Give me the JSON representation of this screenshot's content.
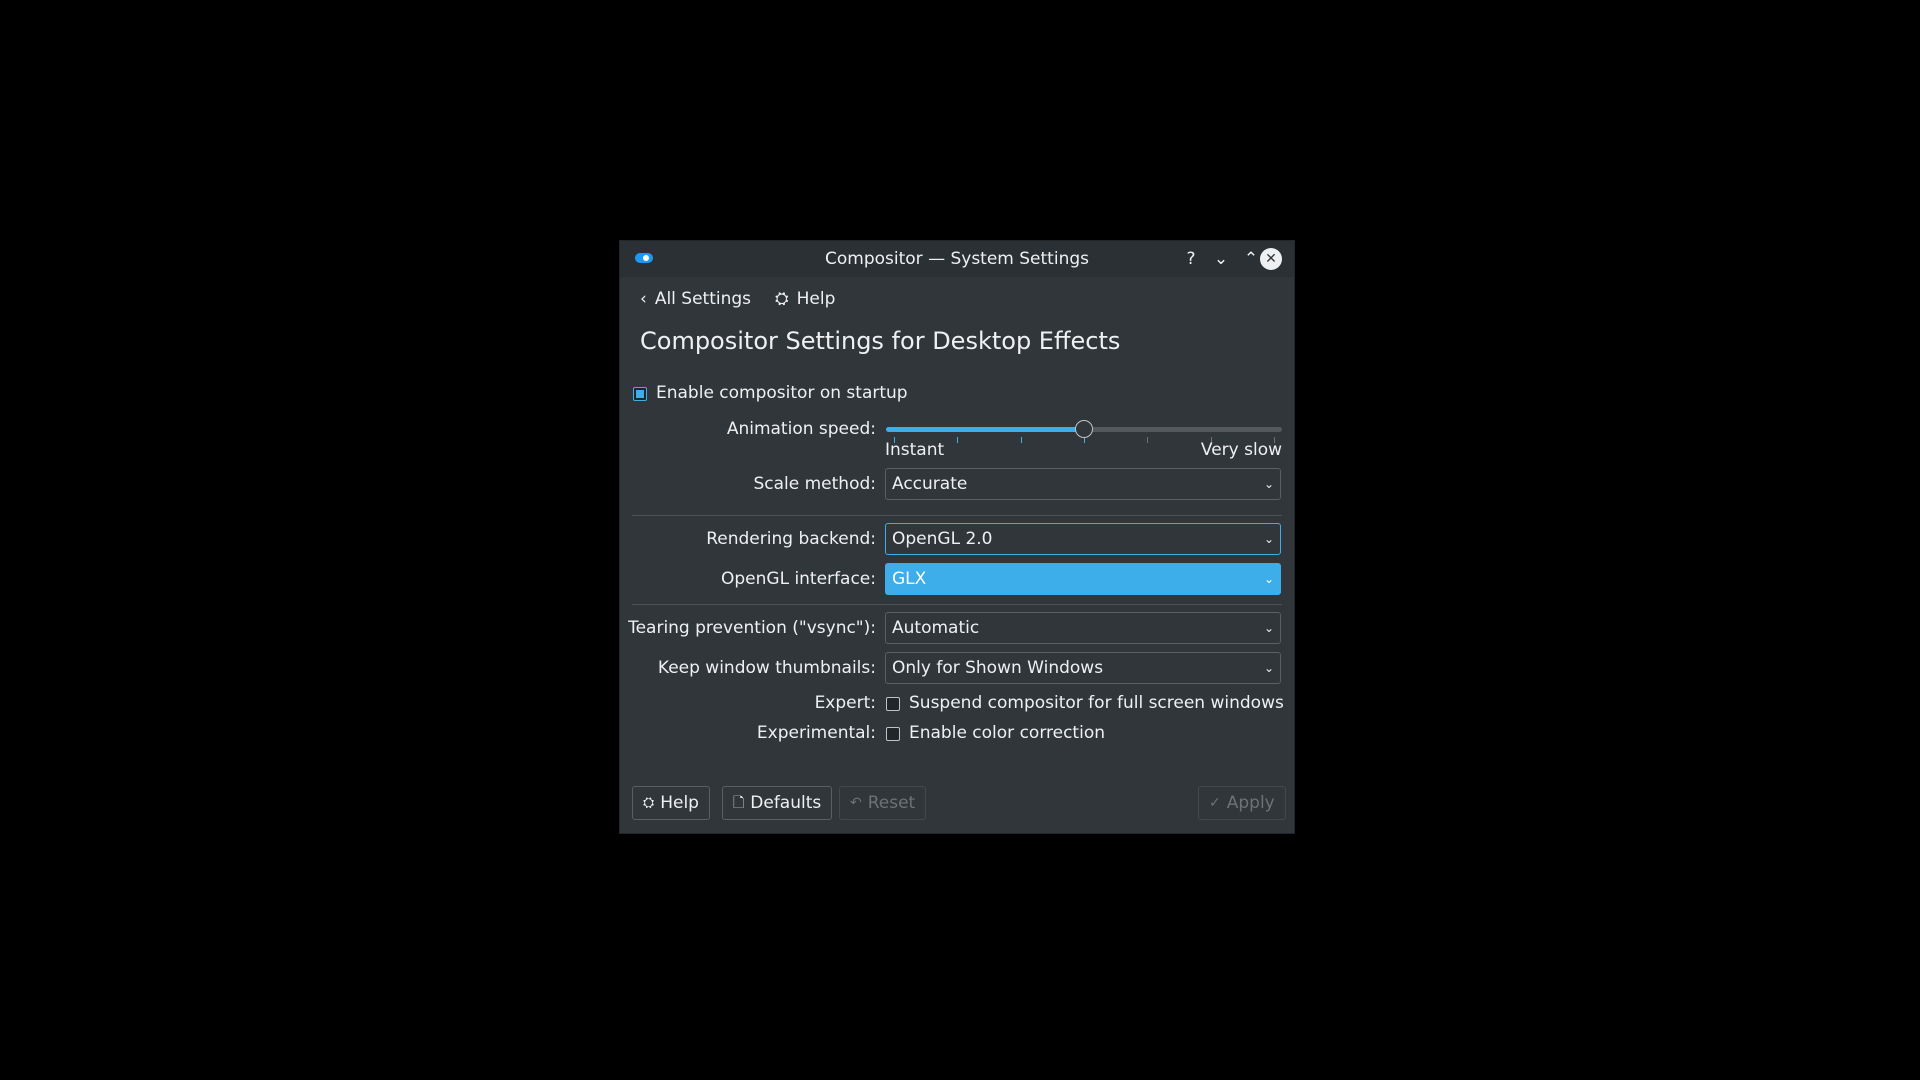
{
  "window": {
    "title": "Compositor  — System Settings",
    "buttons": {
      "help": "?",
      "minimize": "⌄",
      "maximize": "⌃",
      "close": "✕"
    }
  },
  "nav": {
    "back_label": "All Settings",
    "back_icon": "‹",
    "help_label": "Help",
    "help_icon": "⛭"
  },
  "page": {
    "heading": "Compositor Settings for Desktop Effects"
  },
  "form": {
    "enable_startup": {
      "label": "Enable compositor on startup",
      "checked": true
    },
    "animation_speed": {
      "label": "Animation speed:",
      "min_label": "Instant",
      "max_label": "Very slow",
      "value_fraction": 0.5,
      "ticks": 7
    },
    "scale_method": {
      "label": "Scale method:",
      "value": "Accurate"
    },
    "rendering_backend": {
      "label": "Rendering backend:",
      "value": "OpenGL 2.0"
    },
    "opengl_interface": {
      "label": "OpenGL interface:",
      "value": "GLX"
    },
    "tearing_prevention": {
      "label": "Tearing prevention (\"vsync\"):",
      "value": "Automatic"
    },
    "keep_thumbnails": {
      "label": "Keep window thumbnails:",
      "value": "Only for Shown Windows"
    },
    "expert": {
      "label": "Expert:",
      "option": "Suspend compositor for full screen windows",
      "checked": false
    },
    "experimental": {
      "label": "Experimental:",
      "option": "Enable color correction",
      "checked": false
    }
  },
  "footer": {
    "help": "Help",
    "defaults": "Defaults",
    "reset": "Reset",
    "apply": "Apply"
  },
  "colors": {
    "accent": "#3daee9",
    "window_bg": "#31363b",
    "text": "#eff0f1"
  }
}
